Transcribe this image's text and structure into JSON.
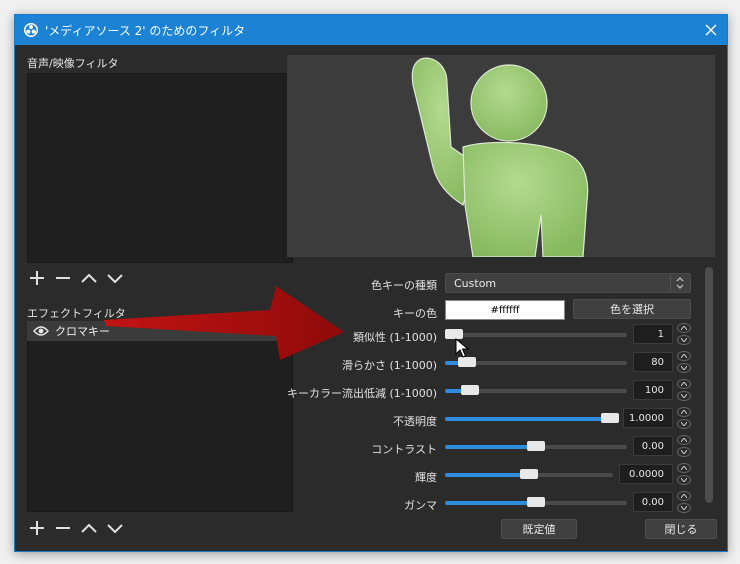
{
  "window": {
    "title": "'メディアソース 2' のためのフィルタ"
  },
  "left": {
    "av_filters_label": "音声/映像フィルタ",
    "effect_filters_label": "エフェクトフィルタ",
    "effect_items": [
      {
        "label": "クロマキー"
      }
    ]
  },
  "props": {
    "key_type": {
      "label": "色キーの種類",
      "value": "Custom"
    },
    "key_color": {
      "label": "キーの色",
      "value": "#ffffff",
      "select_label": "色を選択"
    },
    "similarity": {
      "label": "類似性 (1-1000)",
      "value": "1",
      "fraction": 0.0
    },
    "smoothness": {
      "label": "滑らかさ (1-1000)",
      "value": "80",
      "fraction": 0.08
    },
    "spill": {
      "label": "キーカラー流出低減 (1-1000)",
      "value": "100",
      "fraction": 0.1
    },
    "opacity": {
      "label": "不透明度",
      "value": "1.0000",
      "fraction": 1.0
    },
    "contrast": {
      "label": "コントラスト",
      "value": "0.00",
      "fraction": 0.5
    },
    "brightness": {
      "label": "輝度",
      "value": "0.0000",
      "fraction": 0.5
    },
    "gamma": {
      "label": "ガンマ",
      "value": "0.00",
      "fraction": 0.5
    }
  },
  "buttons": {
    "defaults": "既定値",
    "close": "閉じる"
  },
  "colors": {
    "accent": "#2e8ddf",
    "titlebar": "#1b82d4",
    "figure": "#9dcb75",
    "arrow": "#a80d0d"
  }
}
